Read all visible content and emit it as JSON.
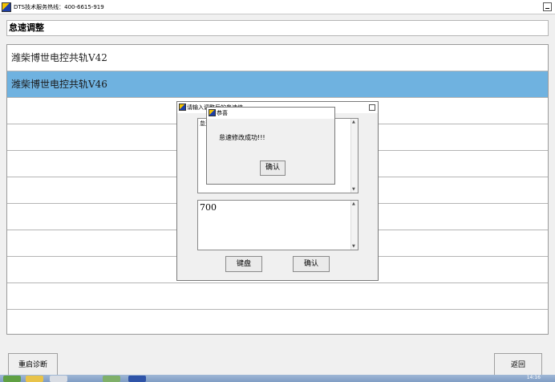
{
  "window": {
    "title": "DTS技术服务热线：400-6615-919"
  },
  "heading": "怠速调整",
  "list": {
    "items": [
      {
        "label": "潍柴博世电控共轨V42",
        "selected": false
      },
      {
        "label": "潍柴博世电控共轨V46",
        "selected": true
      }
    ],
    "empty_rows": 8
  },
  "input_dialog": {
    "title": "请输入调整后的怠速值",
    "info_text": "怠速",
    "value": "700",
    "keyboard_button": "键盘",
    "confirm_button": "确认"
  },
  "message_box": {
    "title": "恭喜",
    "message": "怠速修改成功!!!",
    "ok_button": "确认"
  },
  "footer": {
    "restart_button": "重启诊断",
    "back_button": "返回"
  },
  "taskbar": {
    "clock": "14:16"
  },
  "colors": {
    "selection": "#6fb2e0",
    "window_bg": "#f0f0f0"
  }
}
